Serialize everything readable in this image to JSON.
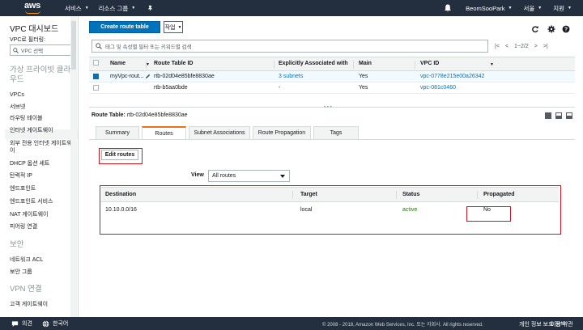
{
  "topnav": {
    "logo": "aws",
    "services": "서비스",
    "resource_groups": "리소스 그룹",
    "user": "BeomSooPark",
    "region": "서울",
    "support": "지원"
  },
  "sidebar": {
    "title": "VPC 대시보드",
    "filter_label": "VPC로 필터링:",
    "filter_placeholder": "VPC 선택",
    "section_virtual": "가상 프라이빗 클라우드",
    "items_virtual": [
      "VPCs",
      "서브넷",
      "라우팅 테이블",
      "인터넷 게이트웨이",
      "외부 전용 인터넷 게이트웨이",
      "DHCP 옵션 세트",
      "탄력적 IP",
      "엔드포인트",
      "엔드포인트 서비스",
      "NAT 게이트웨이",
      "피어링 연결"
    ],
    "section_security": "보안",
    "items_security": [
      "네트워크 ACL",
      "보안 그룹"
    ],
    "section_vpn": "VPN 연결",
    "items_vpn": [
      "고객 게이트웨이"
    ]
  },
  "toolbar": {
    "create_label": "Create route table",
    "actions_label": "작업"
  },
  "search": {
    "placeholder": "태그 및 속성별 필터 또는 키워드별 검색",
    "page_info": "1~2/2"
  },
  "table": {
    "headers": [
      "Name",
      "Route Table ID",
      "Explicitly Associated with",
      "Main",
      "VPC ID"
    ],
    "rows": [
      {
        "name": "myVpc-rout...",
        "id": "rtb-02d04e85bfe8830ae",
        "assoc": "3 subnets",
        "main": "Yes",
        "vpc": "vpc-0778e215e00a26342"
      },
      {
        "name": "",
        "id": "rtb-b5aa0bde",
        "assoc": "-",
        "main": "Yes",
        "vpc": "vpc-081c0460"
      }
    ]
  },
  "detail": {
    "label": "Route Table:",
    "id": "rtb-02d04e85bfe8830ae",
    "tabs": [
      "Summary",
      "Routes",
      "Subnet Associations",
      "Route Propagation",
      "Tags"
    ],
    "edit_routes": "Edit routes",
    "view_label": "View",
    "view_value": "All routes",
    "route_headers": [
      "Destination",
      "Target",
      "Status",
      "Propagated"
    ],
    "routes": [
      {
        "destination": "10.10.0.0/16",
        "target": "local",
        "status": "active",
        "propagated": "No"
      }
    ]
  },
  "footer": {
    "feedback": "의견",
    "language": "한국어",
    "copyright": "© 2008 - 2018, Amazon Web Services, Inc. 또는 자회사. All rights reserved.",
    "privacy": "개인 정보 보호 정책",
    "terms": "이용 약관"
  }
}
